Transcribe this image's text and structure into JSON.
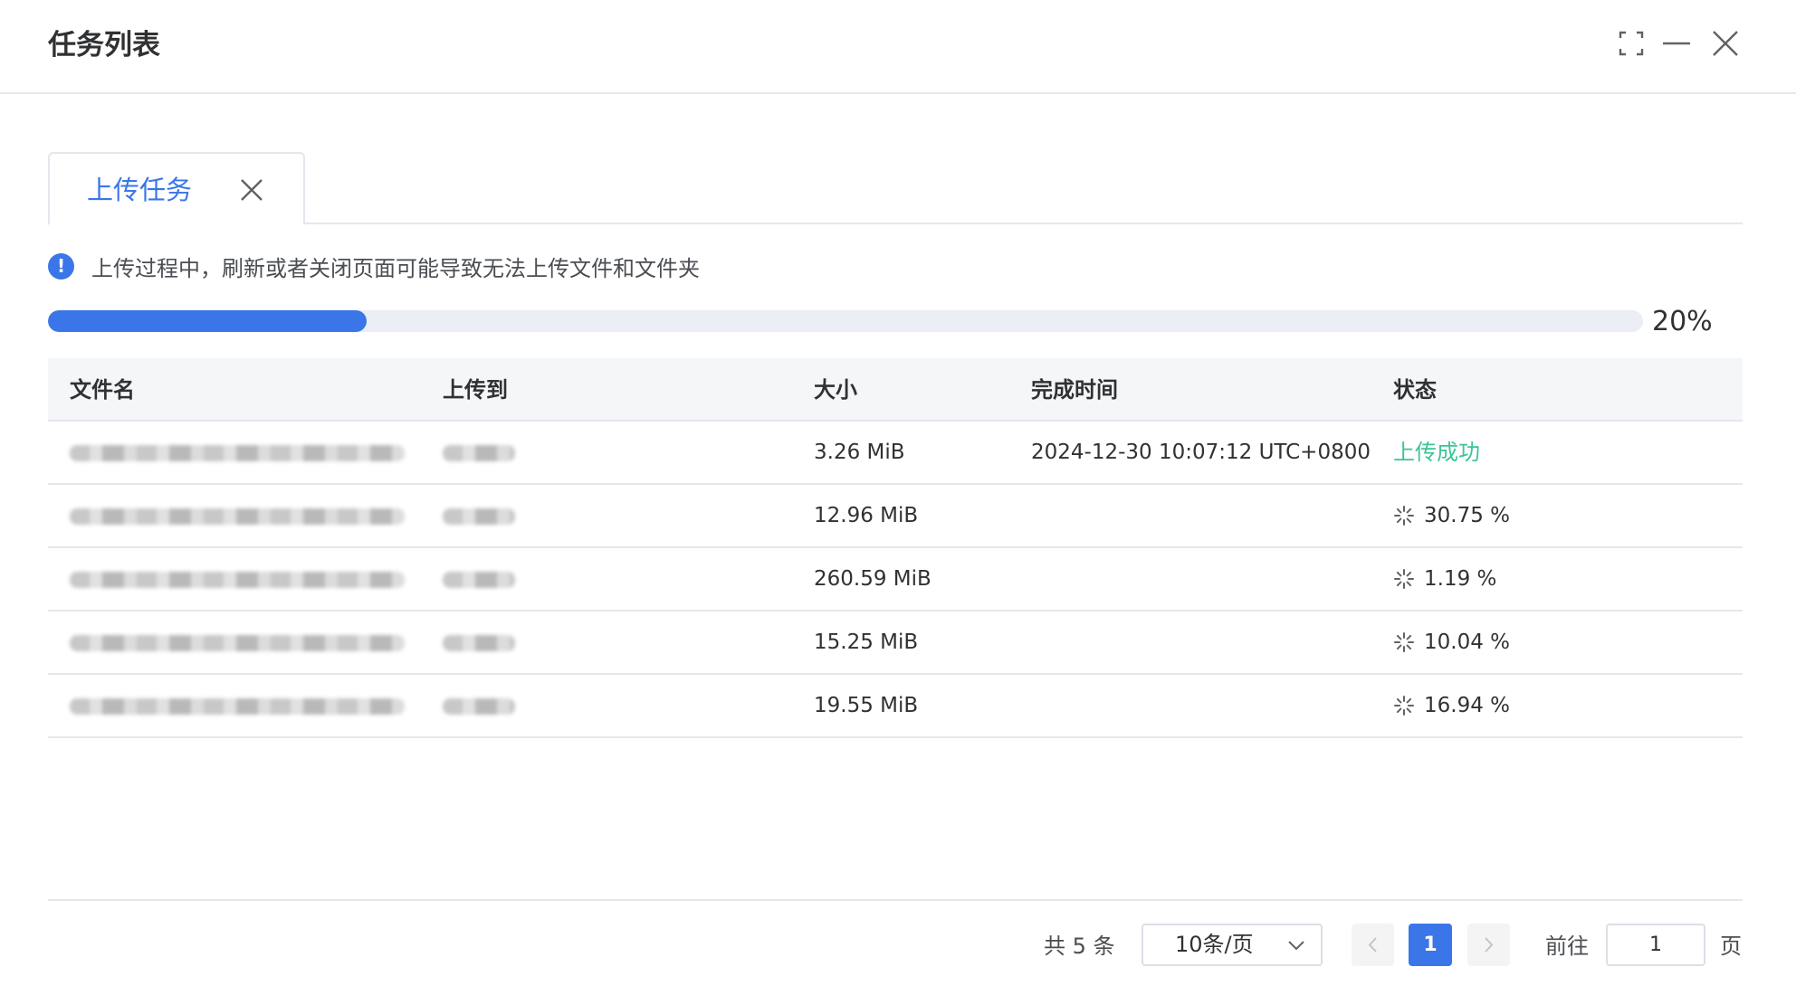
{
  "dialog": {
    "title": "任务列表",
    "icons": {
      "maximize": "maximize-icon",
      "minimize": "minimize-icon",
      "close": "close-icon"
    }
  },
  "tabs": [
    {
      "label": "上传任务",
      "active": true
    }
  ],
  "notice": {
    "icon_symbol": "!",
    "text": "上传过程中，刷新或者关闭页面可能导致无法上传文件和文件夹"
  },
  "progress": {
    "percent": 20,
    "label": "20%",
    "color": "#3a76e8"
  },
  "table": {
    "columns": [
      "文件名",
      "上传到",
      "大小",
      "完成时间",
      "状态"
    ],
    "rows": [
      {
        "size": "3.26 MiB",
        "completed": "2024-12-30 10:07:12 UTC+0800",
        "status": "上传成功",
        "status_type": "success"
      },
      {
        "size": "12.96 MiB",
        "completed": "",
        "status": "30.75 %",
        "status_type": "uploading"
      },
      {
        "size": "260.59 MiB",
        "completed": "",
        "status": "1.19 %",
        "status_type": "uploading"
      },
      {
        "size": "15.25 MiB",
        "completed": "",
        "status": "10.04 %",
        "status_type": "uploading"
      },
      {
        "size": "19.55 MiB",
        "completed": "",
        "status": "16.94 %",
        "status_type": "uploading"
      }
    ]
  },
  "pagination": {
    "total_text": "共 5 条",
    "page_size": "10条/页",
    "current_page": "1",
    "goto_label": "前往",
    "goto_value": "1",
    "goto_suffix": "页"
  },
  "colors": {
    "accent": "#3a76e8",
    "success": "#3cc497",
    "border": "#e4e7ed"
  }
}
